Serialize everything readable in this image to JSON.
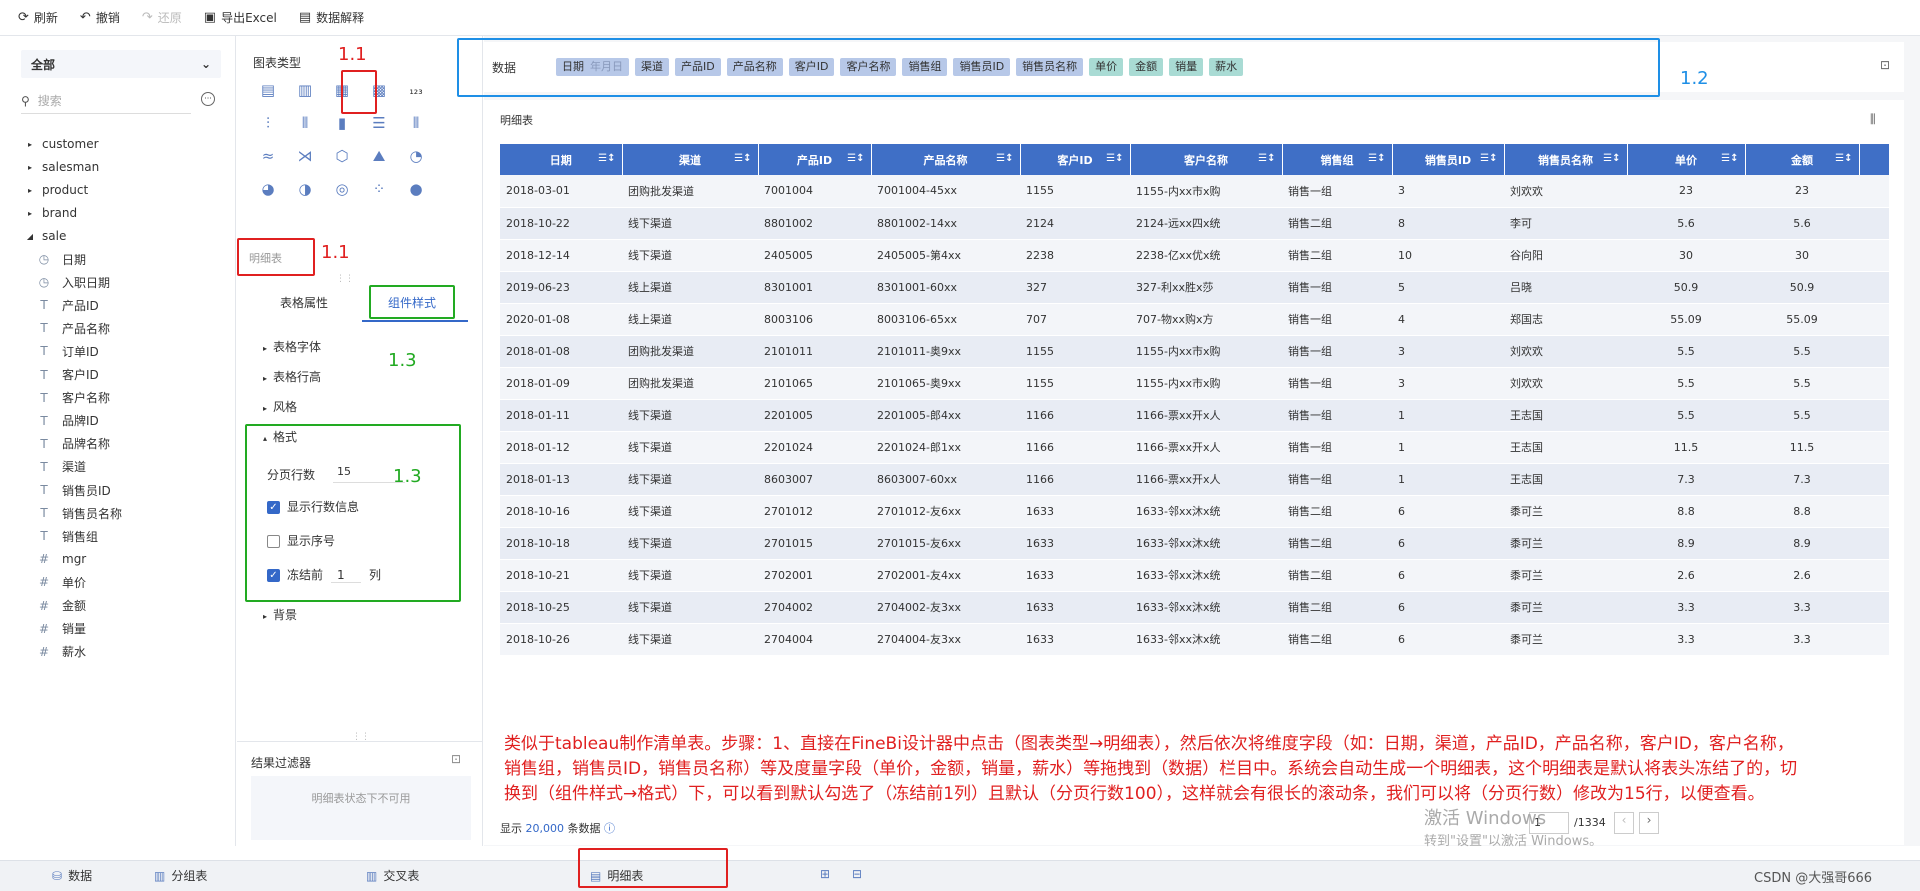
{
  "toolbar": {
    "refresh": "刷新",
    "undo": "撤销",
    "redo": "还原",
    "export": "导出Excel",
    "explain": "数据解释"
  },
  "left": {
    "dropdown": "全部",
    "search_placeholder": "搜索",
    "groups": [
      "customer",
      "salesman",
      "product",
      "brand",
      "sale"
    ],
    "fields": [
      {
        "type": "date",
        "name": "日期"
      },
      {
        "type": "date",
        "name": "入职日期"
      },
      {
        "type": "text",
        "name": "产品ID"
      },
      {
        "type": "text",
        "name": "产品名称"
      },
      {
        "type": "text",
        "name": "订单ID"
      },
      {
        "type": "text",
        "name": "客户ID"
      },
      {
        "type": "text",
        "name": "客户名称"
      },
      {
        "type": "text",
        "name": "品牌ID"
      },
      {
        "type": "text",
        "name": "品牌名称"
      },
      {
        "type": "text",
        "name": "渠道"
      },
      {
        "type": "text",
        "name": "销售员ID"
      },
      {
        "type": "text",
        "name": "销售员名称"
      },
      {
        "type": "text",
        "name": "销售组"
      },
      {
        "type": "num",
        "name": "mgr"
      },
      {
        "type": "num",
        "name": "单价"
      },
      {
        "type": "num",
        "name": "金额"
      },
      {
        "type": "num",
        "name": "销量"
      },
      {
        "type": "num",
        "name": "薪水"
      }
    ]
  },
  "mid": {
    "chart_type_label": "图表类型",
    "selected_chart": "明细表",
    "tab_table_props": "表格属性",
    "tab_component_style": "组件样式",
    "sections": {
      "font": "表格字体",
      "row_height": "表格行高",
      "style": "风格",
      "format": "格式",
      "background": "背景"
    },
    "format": {
      "page_rows_label": "分页行数",
      "page_rows_value": "15",
      "show_row_count": "显示行数信息",
      "show_index": "显示序号",
      "freeze_prefix": "冻结前",
      "freeze_value": "1",
      "freeze_suffix": "列"
    },
    "result_filter": "结果过滤器",
    "filter_unavailable": "明细表状态下不可用"
  },
  "annotations": {
    "a11": "1.1",
    "a11b": "1.1",
    "a12": "1.2",
    "a13": "1.3",
    "a13b": "1.3"
  },
  "databar": {
    "label": "数据",
    "date_field": "日期",
    "date_gran": "年月日",
    "dims": [
      "渠道",
      "产品ID",
      "产品名称",
      "客户ID",
      "客户名称",
      "销售组",
      "销售员ID",
      "销售员名称"
    ],
    "measures": [
      "单价",
      "金额",
      "销量",
      "薪水"
    ]
  },
  "panel": {
    "title": "明细表"
  },
  "table": {
    "headers": [
      "日期",
      "渠道",
      "产品ID",
      "产品名称",
      "客户ID",
      "客户名称",
      "销售组",
      "销售员ID",
      "销售员名称",
      "单价",
      "金额"
    ],
    "rows": [
      [
        "2018-03-01",
        "团购批发渠道",
        "7001004",
        "7001004-45xx",
        "1155",
        "1155-内xx市x购",
        "销售一组",
        "3",
        "刘欢欢",
        "23",
        "23"
      ],
      [
        "2018-10-22",
        "线下渠道",
        "8801002",
        "8801002-14xx",
        "2124",
        "2124-远xx四x统",
        "销售二组",
        "8",
        "李可",
        "5.6",
        "5.6"
      ],
      [
        "2018-12-14",
        "线下渠道",
        "2405005",
        "2405005-第4xx",
        "2238",
        "2238-亿xx优x统",
        "销售二组",
        "10",
        "谷向阳",
        "30",
        "30"
      ],
      [
        "2019-06-23",
        "线上渠道",
        "8301001",
        "8301001-60xx",
        "327",
        "327-利xx胜x莎",
        "销售一组",
        "5",
        "吕晓",
        "50.9",
        "50.9"
      ],
      [
        "2020-01-08",
        "线上渠道",
        "8003106",
        "8003106-65xx",
        "707",
        "707-物xx购x方",
        "销售一组",
        "4",
        "郑国志",
        "55.09",
        "55.09"
      ],
      [
        "2018-01-08",
        "团购批发渠道",
        "2101011",
        "2101011-奥9xx",
        "1155",
        "1155-内xx市x购",
        "销售一组",
        "3",
        "刘欢欢",
        "5.5",
        "5.5"
      ],
      [
        "2018-01-09",
        "团购批发渠道",
        "2101065",
        "2101065-奥9xx",
        "1155",
        "1155-内xx市x购",
        "销售一组",
        "3",
        "刘欢欢",
        "5.5",
        "5.5"
      ],
      [
        "2018-01-11",
        "线下渠道",
        "2201005",
        "2201005-郎4xx",
        "1166",
        "1166-票xx开x人",
        "销售一组",
        "1",
        "王志国",
        "5.5",
        "5.5"
      ],
      [
        "2018-01-12",
        "线下渠道",
        "2201024",
        "2201024-郎1xx",
        "1166",
        "1166-票xx开x人",
        "销售一组",
        "1",
        "王志国",
        "11.5",
        "11.5"
      ],
      [
        "2018-01-13",
        "线下渠道",
        "8603007",
        "8603007-60xx",
        "1166",
        "1166-票xx开x人",
        "销售一组",
        "1",
        "王志国",
        "7.3",
        "7.3"
      ],
      [
        "2018-10-16",
        "线下渠道",
        "2701012",
        "2701012-友6xx",
        "1633",
        "1633-邻xx沐x统",
        "销售二组",
        "6",
        "黍可兰",
        "8.8",
        "8.8"
      ],
      [
        "2018-10-18",
        "线下渠道",
        "2701015",
        "2701015-友6xx",
        "1633",
        "1633-邻xx沐x统",
        "销售二组",
        "6",
        "黍可兰",
        "8.9",
        "8.9"
      ],
      [
        "2018-10-21",
        "线下渠道",
        "2702001",
        "2702001-友4xx",
        "1633",
        "1633-邻xx沐x统",
        "销售二组",
        "6",
        "黍可兰",
        "2.6",
        "2.6"
      ],
      [
        "2018-10-25",
        "线下渠道",
        "2704002",
        "2704002-友3xx",
        "1633",
        "1633-邻xx沐x统",
        "销售二组",
        "6",
        "黍可兰",
        "3.3",
        "3.3"
      ],
      [
        "2018-10-26",
        "线下渠道",
        "2704004",
        "2704004-友3xx",
        "1633",
        "1633-邻xx沐x统",
        "销售二组",
        "6",
        "黍可兰",
        "3.3",
        "3.3"
      ]
    ]
  },
  "note": "类似于tableau制作清单表。步骤：1、直接在FineBi设计器中点击（图表类型→明细表），然后依次将维度字段（如：日期，渠道，产品ID，产品名称，客户ID，客户名称，销售组，销售员ID，销售员名称）等及度量字段（单价，金额，销量，薪水）等拖拽到（数据）栏目中。系统会自动生成一个明细表，这个明细表是默认将表头冻结了的，切换到（组件样式→格式）下，可以看到默认勾选了（冻结前1列）且默认（分页行数100），这样就会有很长的滚动条，我们可以将（分页行数）修改为15行，以便查看。",
  "footer": {
    "show": "显示",
    "count": "20,000",
    "suffix": "条数据",
    "page_value": "1",
    "page_total": "/1334"
  },
  "watermark": {
    "line1": "激活 Windows",
    "line2": "转到\"设置\"以激活 Windows。"
  },
  "bottom": {
    "data": "数据",
    "group_table": "分组表",
    "cross_table": "交叉表",
    "detail_table": "明细表",
    "credit": "CSDN @大强哥666"
  }
}
